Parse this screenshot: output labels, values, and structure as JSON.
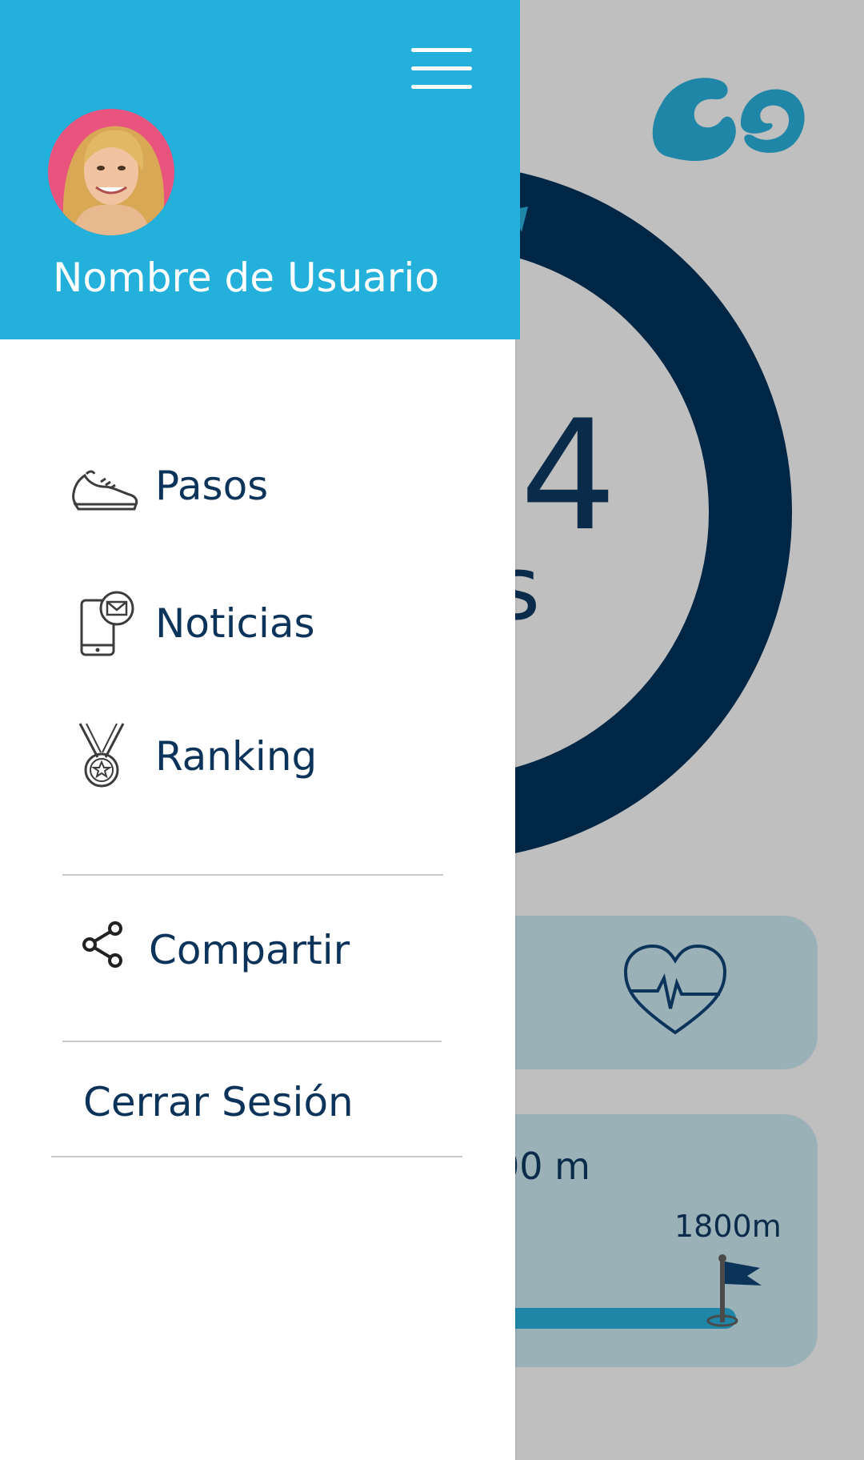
{
  "background": {
    "step_count_partial": "4",
    "step_unit_partial": "s",
    "distance_partial": "00 m",
    "goal_label": "1800m",
    "logo_icon": "go-logo-icon",
    "heart_icon": "heart-rate-icon",
    "flag_icon": "goal-flag-icon"
  },
  "drawer": {
    "menu_icon": "hamburger-icon",
    "avatar_icon": "user-avatar",
    "user_name": "Nombre de Usuario",
    "items": [
      {
        "label": "Pasos",
        "icon": "sneaker-icon"
      },
      {
        "label": "Noticias",
        "icon": "phone-message-icon"
      },
      {
        "label": "Ranking",
        "icon": "medal-icon"
      }
    ],
    "share": {
      "label": "Compartir",
      "icon": "share-icon"
    },
    "logout_label": "Cerrar Sesión"
  },
  "colors": {
    "header": "#23b0db",
    "text_dark": "#0c3359",
    "ring": "#002645",
    "card": "#9bb1b8",
    "track": "#1f86a8",
    "page_bg": "#bfbfbf"
  }
}
